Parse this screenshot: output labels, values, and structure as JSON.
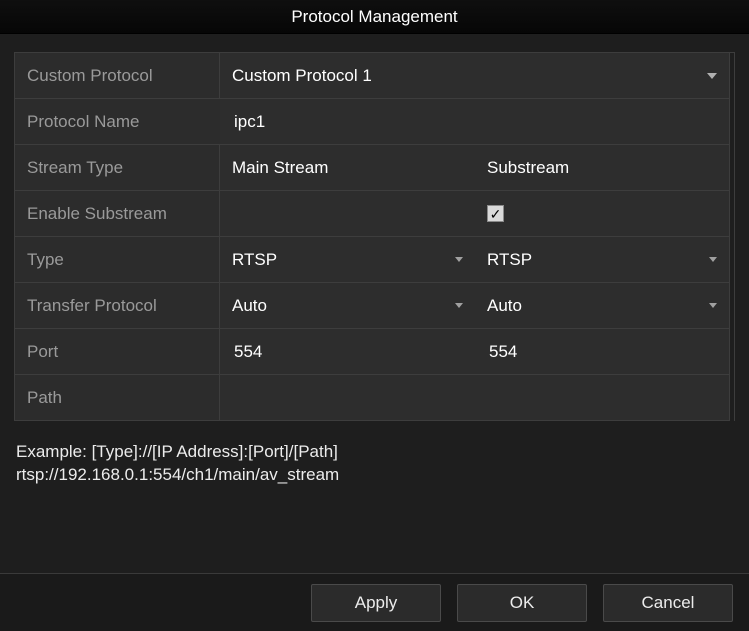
{
  "title": "Protocol Management",
  "labels": {
    "custom_protocol": "Custom Protocol",
    "protocol_name": "Protocol Name",
    "stream_type": "Stream Type",
    "enable_substream": "Enable Substream",
    "type": "Type",
    "transfer_protocol": "Transfer Protocol",
    "port": "Port",
    "path": "Path"
  },
  "values": {
    "custom_protocol": "Custom Protocol 1",
    "protocol_name": "ipc1",
    "columns": {
      "main": "Main Stream",
      "sub": "Substream"
    },
    "enable_substream": {
      "main": "",
      "sub_checked": true
    },
    "type": {
      "main": "RTSP",
      "sub": "RTSP"
    },
    "transfer_protocol": {
      "main": "Auto",
      "sub": "Auto"
    },
    "port": {
      "main": "554",
      "sub": "554"
    },
    "path": {
      "main": "",
      "sub": ""
    }
  },
  "example": {
    "line1": "Example: [Type]://[IP Address]:[Port]/[Path]",
    "line2": "rtsp://192.168.0.1:554/ch1/main/av_stream"
  },
  "buttons": {
    "apply": "Apply",
    "ok": "OK",
    "cancel": "Cancel"
  }
}
